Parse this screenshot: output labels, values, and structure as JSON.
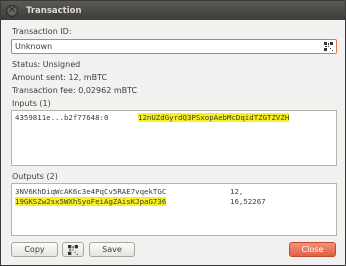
{
  "window": {
    "title": "Transaction"
  },
  "labels": {
    "txid": "Transaction ID:",
    "status": "Status: Unsigned",
    "amount": "Amount sent: 12, mBTC",
    "fee": "Transaction fee: 0,02962 mBTC",
    "inputs": "Inputs (1)",
    "outputs": "Outputs (2)"
  },
  "txid_value": "Unknown",
  "inputs": [
    {
      "prevout": "4359811e...b2f77648:0",
      "address": "12nUZdGyrdQ3PSxopAebMcDqidTZGTZVZH",
      "highlighted": true
    }
  ],
  "outputs": [
    {
      "address": "3NV6KhDiqWcAK6c3e4PqCv5RAE7vqekTGC",
      "amount": "12,",
      "highlighted": false
    },
    {
      "address": "19GKSZw2sx5WXhSyoFeiAgZAisKJpaG736",
      "amount": "16,52267",
      "highlighted": true
    }
  ],
  "buttons": {
    "copy": "Copy",
    "save": "Save",
    "close": "Close"
  },
  "icons": {
    "qr_field": "qr-code-icon",
    "qr_button": "qr-code-icon",
    "window_close": "close-icon"
  },
  "colors": {
    "highlight": "#f7f21f",
    "close_button": "#e2613f",
    "field_focus": "#e8734a"
  }
}
